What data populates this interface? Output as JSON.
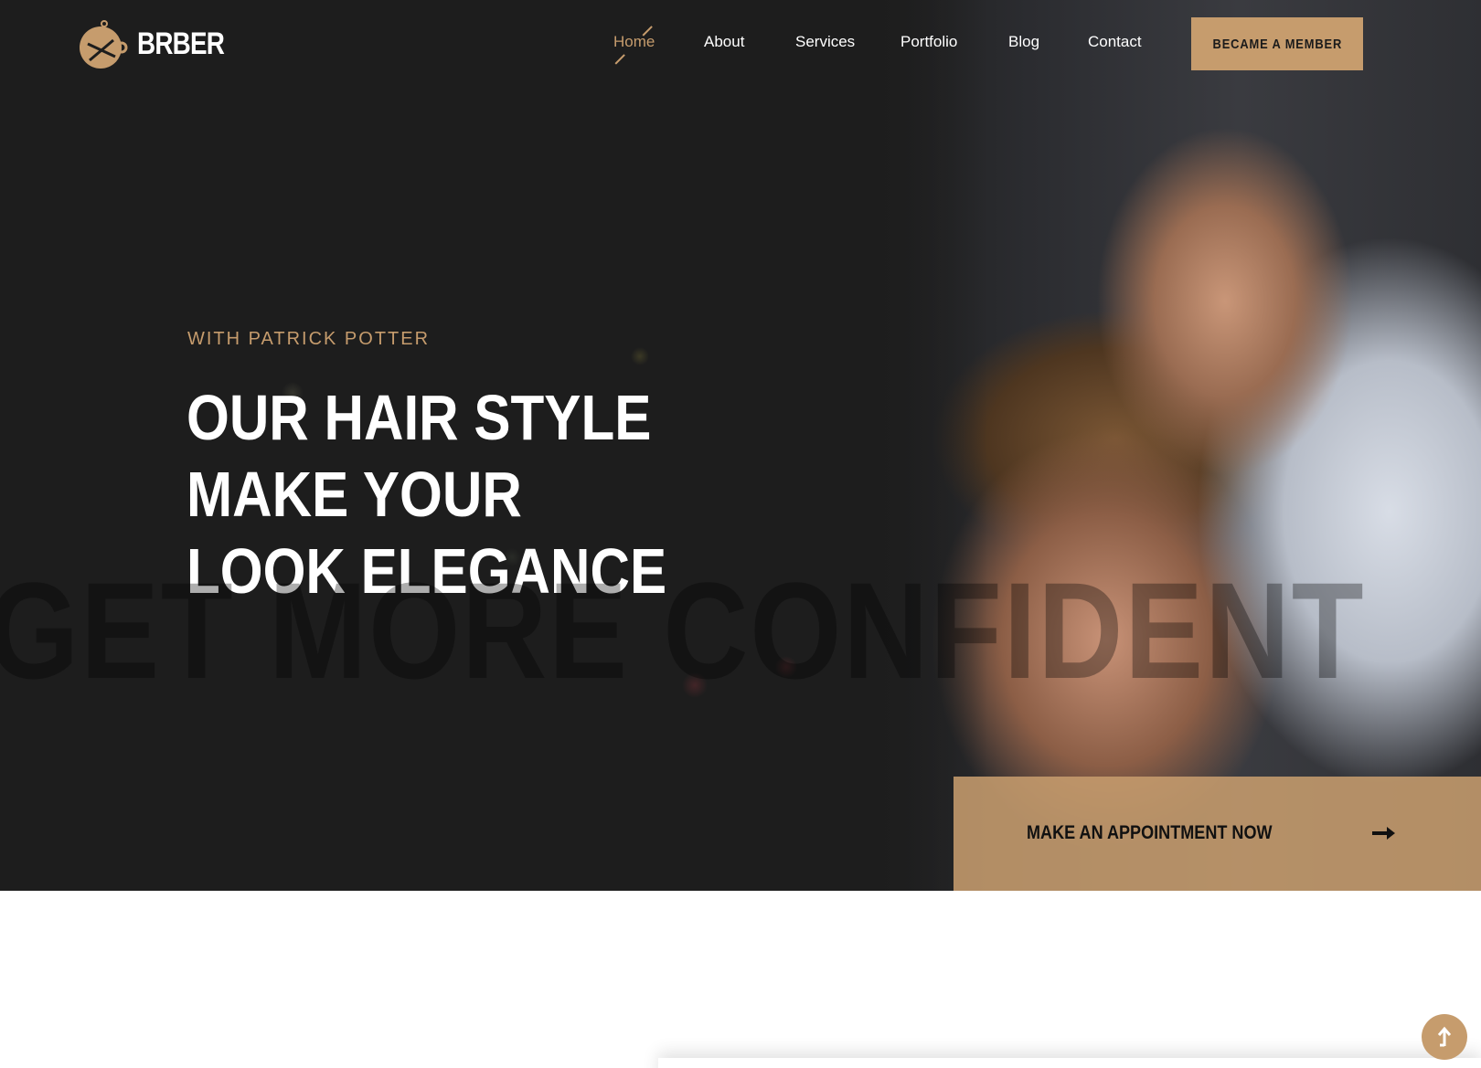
{
  "brand": {
    "name": "BRBER",
    "accent": "#c69c6d"
  },
  "nav": {
    "items": [
      {
        "label": "Home",
        "active": true
      },
      {
        "label": "About",
        "active": false
      },
      {
        "label": "Services",
        "active": false
      },
      {
        "label": "Portfolio",
        "active": false
      },
      {
        "label": "Blog",
        "active": false
      },
      {
        "label": "Contact",
        "active": false
      }
    ],
    "cta_label": "BECAME A MEMBER"
  },
  "hero": {
    "subtitle": "WITH PATRICK POTTER",
    "headline_line1": "OUR HAIR STYLE MAKE YOUR",
    "headline_line2": "LOOK ELEGANCE",
    "watermark": "GET MORE CONFIDENT",
    "appointment_label": "MAKE AN APPOINTMENT NOW",
    "appointment_icon": "arrow-right-icon"
  },
  "scroll_top_icon": "arrow-up-icon"
}
